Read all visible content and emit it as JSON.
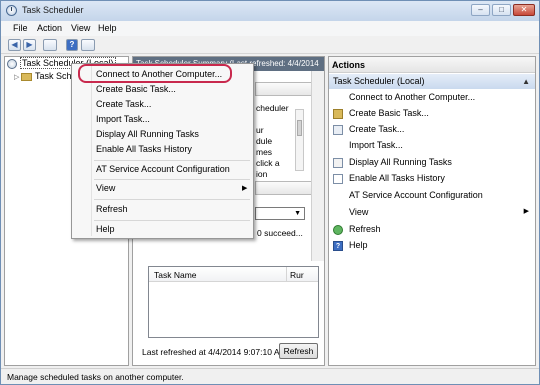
{
  "window": {
    "title": "Task Scheduler",
    "min_glyph": "–",
    "max_glyph": "□",
    "close_glyph": "✕"
  },
  "menubar": {
    "file": "File",
    "action": "Action",
    "view": "View",
    "help": "Help"
  },
  "toolbar": {
    "back_glyph": "◀",
    "forward_glyph": "▶",
    "help_glyph": "?"
  },
  "tree": {
    "root": "Task Scheduler (Local)",
    "child": "Task Scheduler Library"
  },
  "center": {
    "header": "Task Scheduler Summary (Last refreshed: 4/4/2014",
    "fragment_text": "cheduler\n\nur\ndule\nmes\nclick a\nion",
    "status_fragment": "0 succeed...",
    "col_taskname": "Task Name",
    "col_run": "Rur",
    "last_refreshed": "Last refreshed at 4/4/2014 9:07:10 AM",
    "refresh_label": "Refresh"
  },
  "actions": {
    "title": "Actions",
    "group": "Task Scheduler (Local)",
    "items": [
      "Connect to Another Computer...",
      "Create Basic Task...",
      "Create Task...",
      "Import Task...",
      "Display All Running Tasks",
      "Enable All Tasks History",
      "AT Service Account Configuration",
      "View",
      "Refresh",
      "Help"
    ]
  },
  "context_menu": {
    "items": [
      "Connect to Another Computer...",
      "Create Basic Task...",
      "Create Task...",
      "Import Task...",
      "Display All Running Tasks",
      "Enable All Tasks History",
      "AT Service Account Configuration",
      "View",
      "Refresh",
      "Help"
    ]
  },
  "statusbar": {
    "text": "Manage scheduled tasks on another computer."
  },
  "colors": {
    "highlight_ring": "#c8294d",
    "accent": "#3d6ec2",
    "center_header_bg": "#5f6f82"
  },
  "icons": {
    "app": "clock-icon",
    "actions": [
      "none",
      "folder-icon",
      "task-icon",
      "none",
      "display-icon",
      "history-icon",
      "none",
      "none",
      "refresh-icon",
      "help-icon"
    ]
  }
}
